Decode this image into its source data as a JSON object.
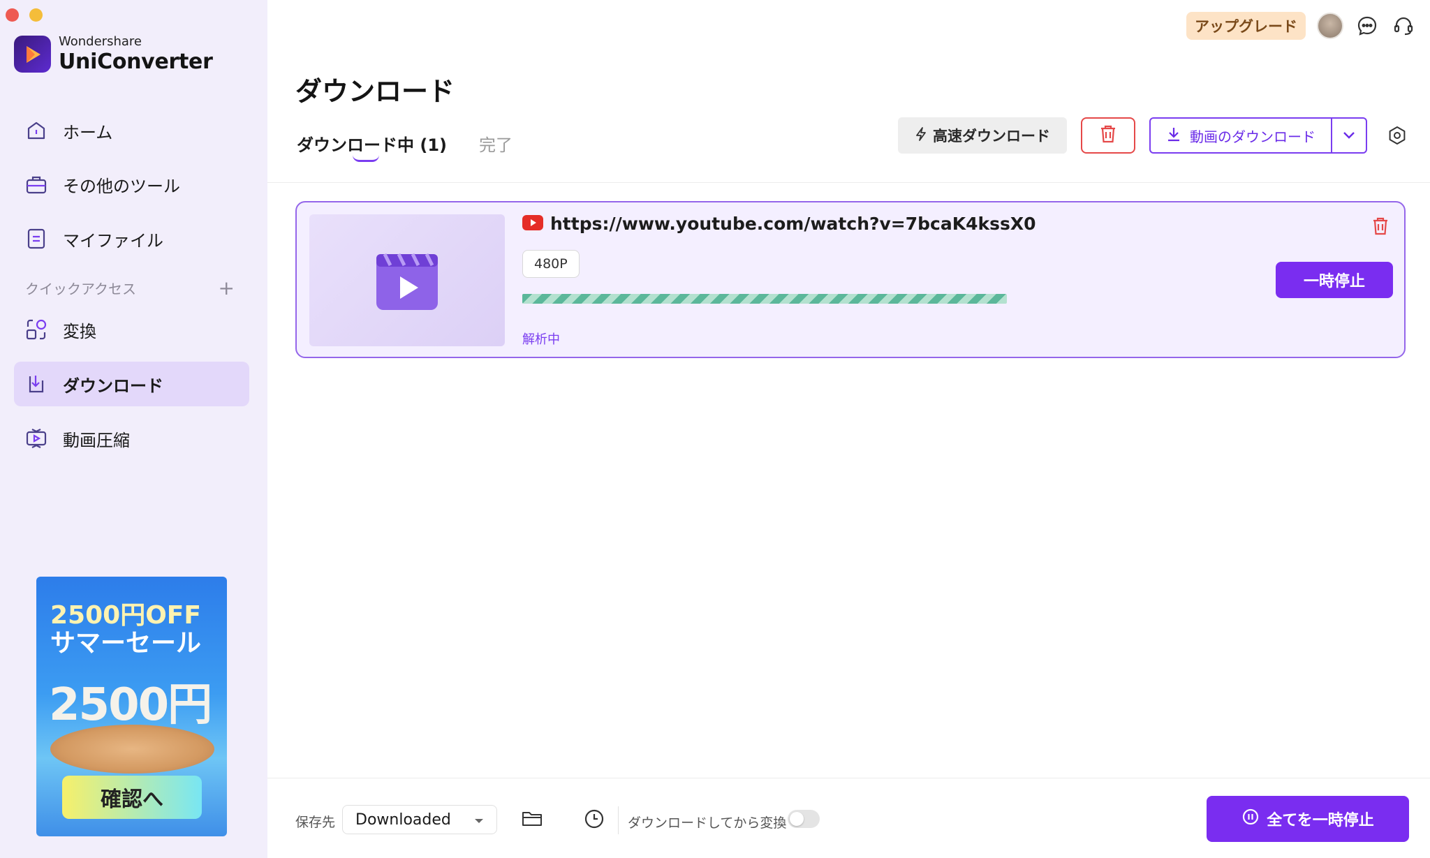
{
  "brand": {
    "small": "Wondershare",
    "name": "UniConverter"
  },
  "sidebar": {
    "items": [
      {
        "label": "ホーム",
        "icon": "home-icon"
      },
      {
        "label": "その他のツール",
        "icon": "toolbox-icon"
      },
      {
        "label": "マイファイル",
        "icon": "file-icon"
      },
      {
        "label": "変換",
        "icon": "convert-icon"
      },
      {
        "label": "ダウンロード",
        "icon": "download-icon"
      },
      {
        "label": "動画圧縮",
        "icon": "compress-icon"
      }
    ],
    "quick_access": "クイックアクセス",
    "active_item": "ダウンロード"
  },
  "promo": {
    "line1": "2500円OFF",
    "line2": "サマーセール",
    "big": "2500円",
    "cta": "確認へ"
  },
  "topbar": {
    "upgrade": "アップグレード"
  },
  "page": {
    "title": "ダウンロード"
  },
  "tabs": {
    "downloading": "ダウンロード中 (1)",
    "done": "完了"
  },
  "toolbar": {
    "fast_download": "高速ダウンロード",
    "download_video": "動画のダウンロード"
  },
  "task": {
    "url": "https://www.youtube.com/watch?v=7bcaK4kssX0",
    "quality": "480P",
    "status": "解析中",
    "pause": "一時停止"
  },
  "bottom": {
    "save_label": "保存先",
    "save_value": "Downloaded",
    "convert_label": "ダウンロードしてから変換",
    "pause_all": "全てを一時停止"
  },
  "colors": {
    "accent": "#7a2df0",
    "danger": "#e54848",
    "sidebar_bg": "#f2eefb"
  }
}
